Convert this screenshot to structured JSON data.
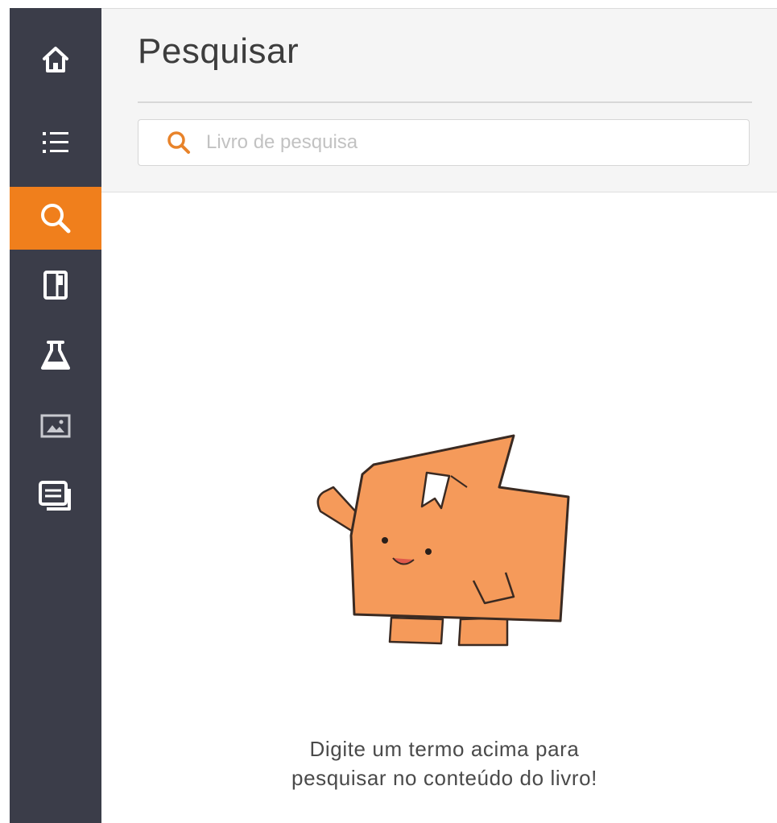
{
  "sidebar": {
    "items": [
      {
        "icon": "home-icon"
      },
      {
        "icon": "list-icon"
      },
      {
        "icon": "search-icon",
        "active": true
      },
      {
        "icon": "book-icon"
      },
      {
        "icon": "flask-icon"
      },
      {
        "icon": "image-icon"
      },
      {
        "icon": "slides-icon"
      }
    ],
    "active_color": "#f07f1c",
    "background": "#3b3d49"
  },
  "header": {
    "title": "Pesquisar"
  },
  "search": {
    "placeholder": "Livro de pesquisa",
    "value": "",
    "icon": "search-icon",
    "icon_color": "#e8832a"
  },
  "empty_state": {
    "illustration": "book-mascot-illustration",
    "message_line1": "Digite um termo acima para",
    "message_line2": "pesquisar no conteúdo do livro!"
  }
}
